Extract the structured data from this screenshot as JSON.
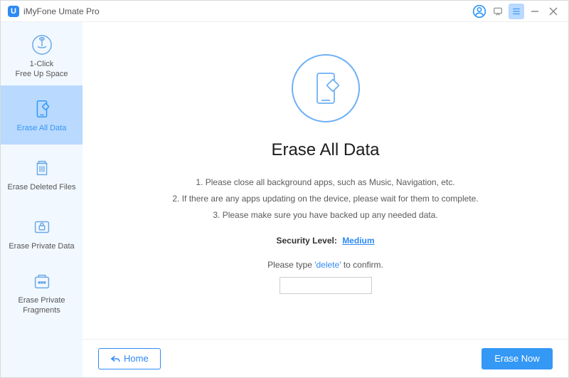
{
  "app": {
    "title": "iMyFone Umate Pro"
  },
  "sidebar": {
    "items": [
      {
        "label": "1-Click\nFree Up Space"
      },
      {
        "label": "Erase All Data"
      },
      {
        "label": "Erase Deleted Files"
      },
      {
        "label": "Erase Private Data"
      },
      {
        "label": "Erase Private\nFragments"
      }
    ]
  },
  "page": {
    "title": "Erase All Data",
    "instructions": [
      "1. Please close all background apps, such as Music, Navigation, etc.",
      "2. If there are any apps updating on the device, please wait for them to complete.",
      "3. Please make sure you have backed up any needed data."
    ],
    "security_label": "Security Level:",
    "security_level": "Medium",
    "confirm_pre": "Please type ",
    "confirm_keyword": "'delete'",
    "confirm_post": " to confirm."
  },
  "footer": {
    "home": "Home",
    "erase": "Erase Now"
  }
}
